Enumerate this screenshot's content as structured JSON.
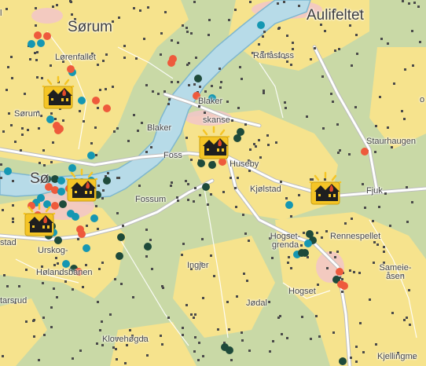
{
  "map": {
    "type": "topographic overview map",
    "colors": {
      "land": "#c9d9a6",
      "settlement": "#f6e38d",
      "urban": "#f2c6c9",
      "water": "#b7dbe8",
      "river_edge": "#7fb7cf",
      "road": "#ffffff",
      "road_casing": "#bdbdbd",
      "marker_red": "#ee5a3c",
      "marker_teal": "#1597b2",
      "marker_dark": "#1e4a3a",
      "building_dot": "#4a4a4a",
      "house_icon_bg": "#f5c526",
      "house_icon_fg": "#1f1f1f",
      "house_icon_accent": "#e24a2a"
    },
    "icon": "house-warning-icon",
    "place_labels": [
      {
        "id": "sorum-town",
        "text": "Sørum",
        "big": true
      },
      {
        "id": "aulifeltet",
        "text": "Aulifeltet",
        "big": true
      },
      {
        "id": "lorenfallet",
        "text": "Lørenfallet"
      },
      {
        "id": "ranasfoss",
        "text": "Rånåsfoss"
      },
      {
        "id": "blaker-upper",
        "text": "Blaker"
      },
      {
        "id": "blaker-skanse",
        "text": "skanse"
      },
      {
        "id": "blaker-lower",
        "text": "Blaker"
      },
      {
        "id": "sorum-small",
        "text": "Sørum"
      },
      {
        "id": "staurhaugen",
        "text": "Staurhaugen"
      },
      {
        "id": "foss",
        "text": "Foss"
      },
      {
        "id": "huseby",
        "text": "Huseby"
      },
      {
        "id": "kjolstad",
        "text": "Kjølstad"
      },
      {
        "id": "fjuk",
        "text": "Fjuk"
      },
      {
        "id": "so",
        "text": "Sø"
      },
      {
        "id": "fossum",
        "text": "Fossum"
      },
      {
        "id": "hogset-grenda",
        "text": "Hogset-\ngrenda"
      },
      {
        "id": "rennespellet",
        "text": "Rennespellet"
      },
      {
        "id": "stad",
        "text": "stad"
      },
      {
        "id": "urskog",
        "text": "Urskog-"
      },
      {
        "id": "ingjer",
        "text": "Ingjer"
      },
      {
        "id": "holandsbanen",
        "text": "Hølandsbanen"
      },
      {
        "id": "sameie-asen",
        "text": "Sameie-\nåsen"
      },
      {
        "id": "hogset",
        "text": "Hogset"
      },
      {
        "id": "tarsrud",
        "text": "tarsrud"
      },
      {
        "id": "jodal",
        "text": "Jødal"
      },
      {
        "id": "klovehogda",
        "text": "Klovehøgda"
      },
      {
        "id": "kjellingme",
        "text": "Kjellingme"
      },
      {
        "id": "edge-l",
        "text": "l"
      },
      {
        "id": "edge-o",
        "text": "o"
      }
    ]
  }
}
